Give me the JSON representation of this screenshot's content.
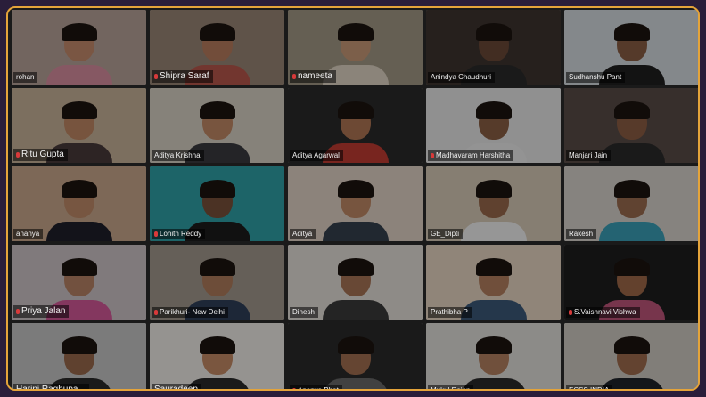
{
  "meeting": {
    "participants": [
      {
        "name": "rohan",
        "muted": false,
        "bg": "#b9a49a",
        "skin": "#c58b6c",
        "shirt": "#d98fa1"
      },
      {
        "name": "Shipra Saraf",
        "muted": true,
        "bg": "#9a8676",
        "skin": "#b97c5e",
        "shirt": "#b8584c"
      },
      {
        "name": "nameeta",
        "muted": true,
        "bg": "#a49a86",
        "skin": "#c99a78",
        "shirt": "#e0d6c6"
      },
      {
        "name": "Anindya Chaudhuri",
        "muted": false,
        "bg": "#3e3530",
        "skin": "#6b4a38",
        "shirt": "#2a2a2a"
      },
      {
        "name": "Sudhanshu Pant",
        "muted": false,
        "bg": "#d6dbe0",
        "skin": "#8a5e45",
        "shirt": "#1f1f1f"
      },
      {
        "name": "Ritu Gupta",
        "muted": true,
        "bg": "#c9b39a",
        "skin": "#c08864",
        "shirt": "#4a3a3a"
      },
      {
        "name": "Aditya Krishna",
        "muted": false,
        "bg": "#d9d2c6",
        "skin": "#c28a66",
        "shirt": "#3a3a40"
      },
      {
        "name": "Aditya Agarwal",
        "muted": false,
        "bg": "#2b2b2b",
        "skin": "#b07755",
        "shirt": "#c23d33"
      },
      {
        "name": "Madhavaram Harshitha",
        "muted": true,
        "bg": "#e8e8e8",
        "skin": "#8b5f45",
        "shirt": "#eeeeee"
      },
      {
        "name": "Manjari Jain",
        "muted": false,
        "bg": "#5a4d48",
        "skin": "#8d5e44",
        "shirt": "#2a2a2a"
      },
      {
        "name": "ananya",
        "muted": false,
        "bg": "#caa98d",
        "skin": "#c08c6a",
        "shirt": "#1f1f2a"
      },
      {
        "name": "Lohith Reddy",
        "muted": true,
        "bg": "#2fa2a8",
        "skin": "#7a523b",
        "shirt": "#1c1c1c"
      },
      {
        "name": "Aditya",
        "muted": false,
        "bg": "#e3d3c7",
        "skin": "#c08a66",
        "shirt": "#36424e"
      },
      {
        "name": "GE_Dipti",
        "muted": false,
        "bg": "#d9cbb8",
        "skin": "#9a6a4c",
        "shirt": "#f2f2f2"
      },
      {
        "name": "Rakesh",
        "muted": false,
        "bg": "#d8d3cd",
        "skin": "#9c6c50",
        "shirt": "#3aa1b8"
      },
      {
        "name": "Priya Jalan",
        "muted": true,
        "bg": "#cfc5c9",
        "skin": "#b88466",
        "shirt": "#d65a9a"
      },
      {
        "name": "Parikhuri- New Delhi",
        "muted": true,
        "bg": "#a39a8f",
        "skin": "#b07c5c",
        "shirt": "#2f3f5a"
      },
      {
        "name": "Dinesh",
        "muted": false,
        "bg": "#e6e1da",
        "skin": "#a87456",
        "shirt": "#3a3a3a"
      },
      {
        "name": "Prathibha P",
        "muted": false,
        "bg": "#e8d7c4",
        "skin": "#b58060",
        "shirt": "#3c5a7a"
      },
      {
        "name": "S.Vaishnavi Vishwa",
        "muted": true,
        "bg": "#1e1e1e",
        "skin": "#a06a4a",
        "shirt": "#c1567b"
      },
      {
        "name": "Harini Raghupa...",
        "muted": false,
        "bg": "#c7c7c7",
        "skin": "#9a6a4c",
        "shirt": "#2a2a2a"
      },
      {
        "name": "Sauradeep",
        "muted": false,
        "bg": "#f0ede8",
        "skin": "#c58c66",
        "shirt": "#2b2b2b"
      },
      {
        "name": "Ananya Bhat",
        "muted": true,
        "bg": "#2a2a2a",
        "skin": "#a47052",
        "shirt": "#6a6a6a"
      },
      {
        "name": "Mukul Rajan",
        "muted": false,
        "bg": "#e3e0dc",
        "skin": "#b58262",
        "shirt": "#2b2b2b"
      },
      {
        "name": "ECSS INDIA",
        "muted": false,
        "bg": "#d1cbc3",
        "skin": "#a06c4e",
        "shirt": "#20242a"
      }
    ]
  }
}
